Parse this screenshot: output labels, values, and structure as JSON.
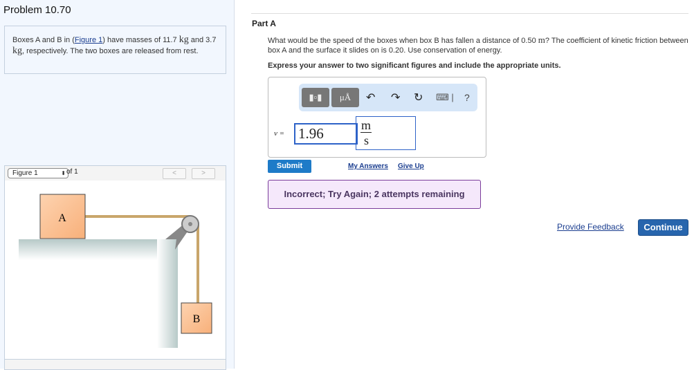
{
  "problem": {
    "title": "Problem 10.70",
    "text_pre": "Boxes A and B in (",
    "figure_link": "Figure 1",
    "text_mid": ") have masses of 11.7 ",
    "unit1": "kg",
    "text_mid2": " and 3.7 ",
    "unit2": "kg",
    "text_post": ", respectively. The two boxes are released from rest."
  },
  "figure": {
    "selected": "Figure 1",
    "of": "of 1",
    "prev": "<",
    "next": ">",
    "label_a": "A",
    "label_b": "B"
  },
  "part": {
    "title": "Part A",
    "question_pre": "What would be the speed of the boxes when box B has fallen a distance of 0.50 ",
    "question_unit": "m",
    "question_post": "? The coefficient of kinetic friction between box A and the surface it slides on is 0.20. Use conservation of energy.",
    "instruction": "Express your answer to two significant figures and include the appropriate units."
  },
  "answer": {
    "variable": "v =",
    "value": "1.96",
    "unit_num": "m",
    "unit_den": "s",
    "toolbar": {
      "units_btn": "μÅ",
      "help": "?"
    }
  },
  "actions": {
    "submit": "Submit",
    "my_answers": "My Answers",
    "give_up": "Give Up"
  },
  "feedback": "Incorrect; Try Again; 2 attempts remaining",
  "footer": {
    "provide_feedback": "Provide Feedback",
    "continue": "Continue"
  }
}
